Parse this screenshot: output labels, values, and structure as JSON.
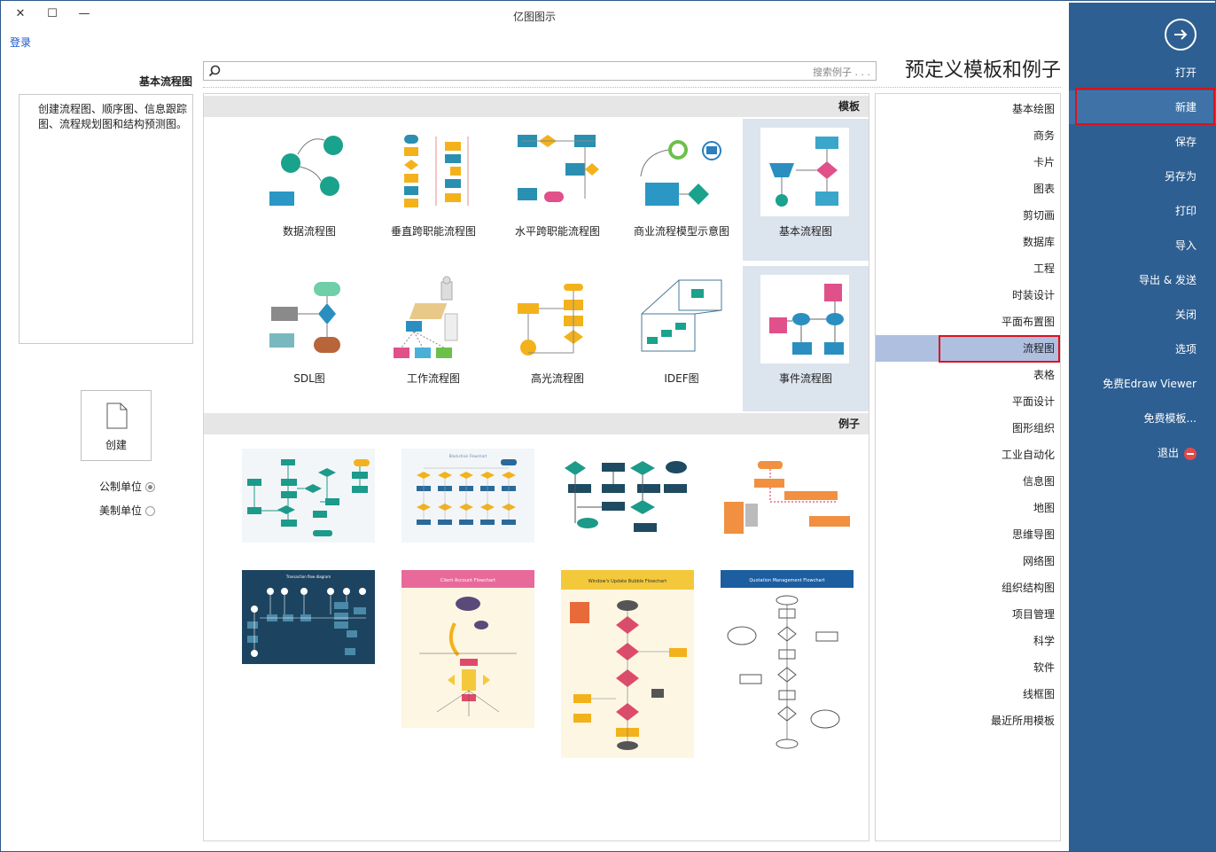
{
  "window": {
    "title": "亿图图示",
    "close_glyph": "✕",
    "max_glyph": "☐",
    "min_glyph": "—",
    "login": "登录"
  },
  "heading": "预定义模板和例子",
  "search": {
    "placeholder": "搜索例子 . . ."
  },
  "sidebar": {
    "items": [
      {
        "label": "打开"
      },
      {
        "label": "新建"
      },
      {
        "label": "保存"
      },
      {
        "label": "另存为"
      },
      {
        "label": "打印"
      },
      {
        "label": "导入"
      },
      {
        "label": "导出 & 发送"
      },
      {
        "label": "关闭"
      },
      {
        "label": "选项"
      },
      {
        "label": "免费Edraw Viewer"
      },
      {
        "label": "免费模板..."
      },
      {
        "label": "退出"
      }
    ],
    "active": "新建"
  },
  "categories": [
    "基本绘图",
    "商务",
    "卡片",
    "图表",
    "剪切画",
    "数据库",
    "工程",
    "时装设计",
    "平面布置图",
    "流程图",
    "表格",
    "平面设计",
    "图形组织",
    "工业自动化",
    "信息图",
    "地图",
    "思维导图",
    "网络图",
    "组织结构图",
    "项目管理",
    "科学",
    "软件",
    "线框图",
    "最近所用模板"
  ],
  "selected_category": "流程图",
  "sections": {
    "templates": "模板",
    "examples": "例子"
  },
  "templates": [
    {
      "label": "基本流程图"
    },
    {
      "label": "商业流程模型示意图"
    },
    {
      "label": "水平跨职能流程图"
    },
    {
      "label": "垂直跨职能流程图"
    },
    {
      "label": "数据流程图"
    },
    {
      "label": "事件流程图"
    },
    {
      "label": "IDEF图"
    },
    {
      "label": "高光流程图"
    },
    {
      "label": "工作流程图"
    },
    {
      "label": "SDL图"
    }
  ],
  "examples": [
    {
      "title": ""
    },
    {
      "title": ""
    },
    {
      "title": "Blockchain Flowchart"
    },
    {
      "title": ""
    },
    {
      "title": "Quotation Management Flowchart"
    },
    {
      "title": "Window's Update Bubble Flowchart"
    },
    {
      "title": "Client Account Flowchart"
    },
    {
      "title": "Transaction flow diagram"
    }
  ],
  "left_panel": {
    "title": "基本流程图",
    "description": "创建流程图、顺序图、信息跟踪图、流程规划图和结构预测图。",
    "create_label": "创建",
    "units": [
      {
        "label": "公制单位",
        "checked": true
      },
      {
        "label": "美制单位",
        "checked": false
      }
    ]
  },
  "colors": {
    "sidebar": "#2e5f92",
    "highlight": "#e0101b",
    "accent_teal": "#1c9a8a",
    "accent_blue": "#2f9fc7"
  }
}
